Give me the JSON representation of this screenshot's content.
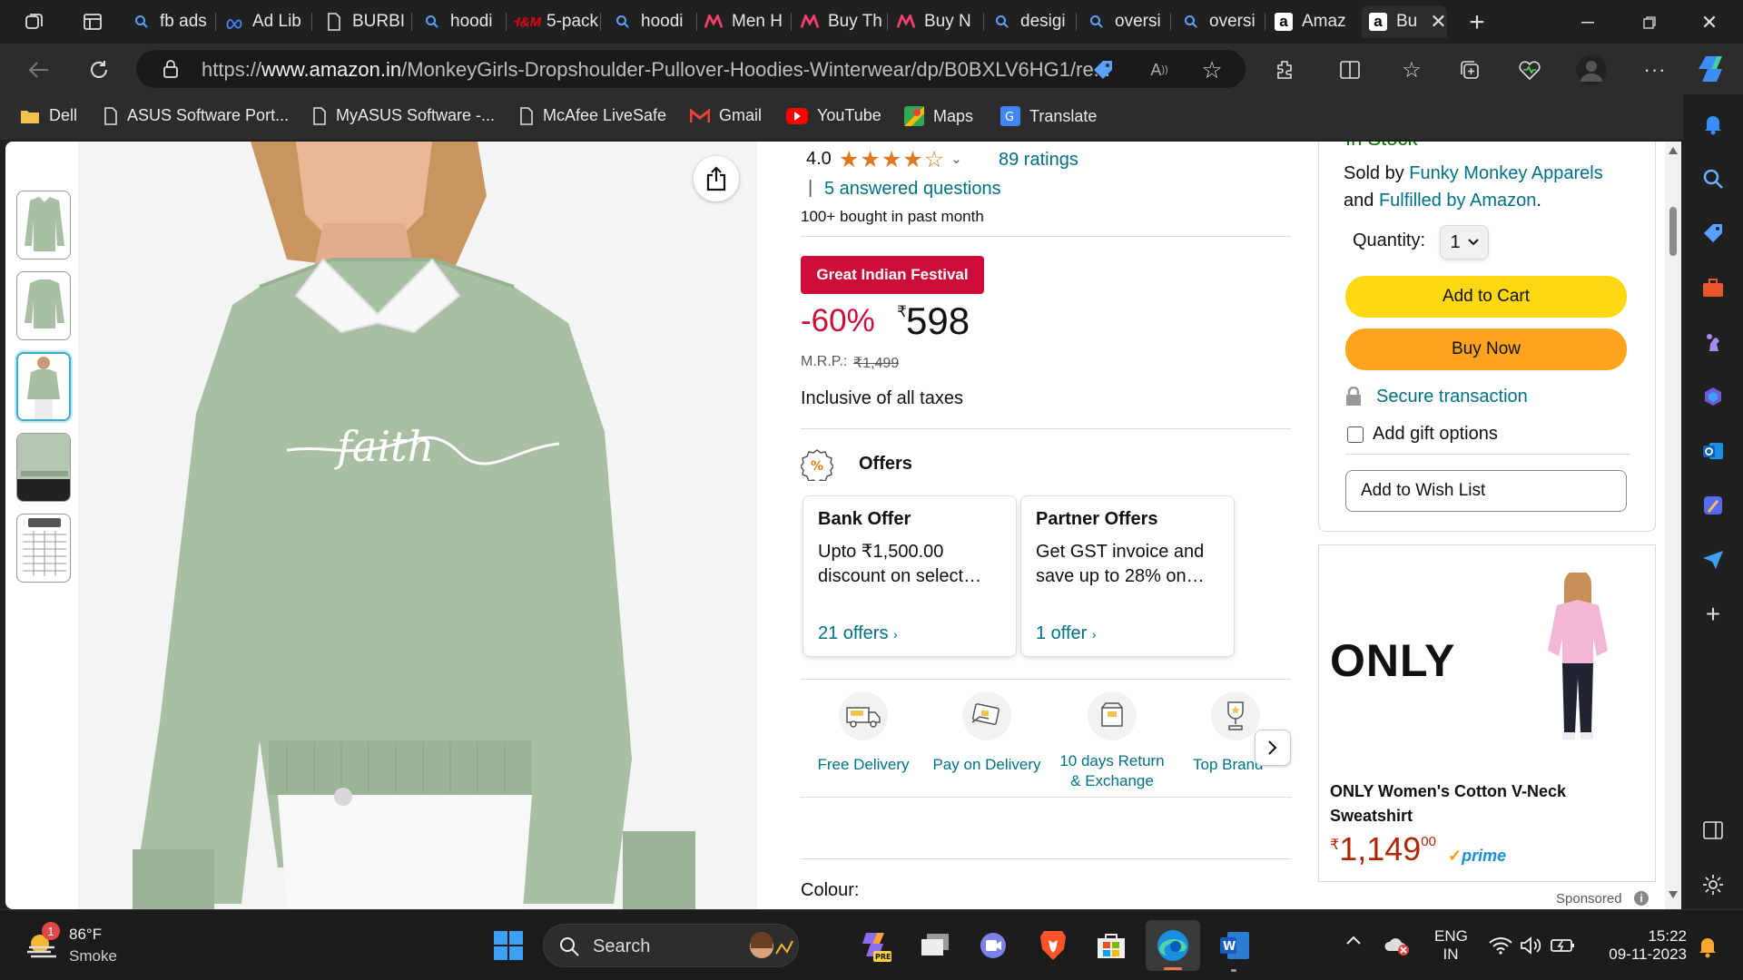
{
  "tabs": [
    {
      "label": "fb ads"
    },
    {
      "label": "Ad Lib"
    },
    {
      "label": "BURBI"
    },
    {
      "label": "hoodi"
    },
    {
      "label": "5-pack"
    },
    {
      "label": "hoodi"
    },
    {
      "label": "Men H"
    },
    {
      "label": "Buy Th"
    },
    {
      "label": "Buy N"
    },
    {
      "label": "desigi"
    },
    {
      "label": "oversi"
    },
    {
      "label": "oversi"
    },
    {
      "label": "Amaz"
    },
    {
      "label": "Bu"
    }
  ],
  "url": {
    "scheme": "https://",
    "domain": "www.amazon.in",
    "path": "/MonkeyGirls-Dropshoulder-Pullover-Hoodies-Winterwear/dp/B0BXLV6HG1/re..."
  },
  "bookmarks": [
    {
      "label": "Dell"
    },
    {
      "label": "ASUS Software Port..."
    },
    {
      "label": "MyASUS Software -..."
    },
    {
      "label": "McAfee LiveSafe"
    },
    {
      "label": "Gmail"
    },
    {
      "label": "YouTube"
    },
    {
      "label": "Maps"
    },
    {
      "label": "Translate"
    }
  ],
  "product": {
    "rating": "4.0",
    "ratings_count": "89 ratings",
    "answered": "5 answered questions",
    "bought": "100+ bought in past month",
    "deal_badge": "Great Indian Festival",
    "discount": "-60%",
    "currency": "₹",
    "price": "598",
    "mrp_label": "M.R.P.:",
    "mrp": "₹1,499",
    "taxes": "Inclusive of all taxes",
    "shirt_text": "faith",
    "colour_label": "Colour:"
  },
  "offers": {
    "title": "Offers",
    "cards": [
      {
        "title": "Bank Offer",
        "line1": "Upto ₹1,500.00",
        "line2": "discount on select…",
        "link": "21 offers"
      },
      {
        "title": "Partner Offers",
        "line1": "Get GST invoice and",
        "line2": "save up to 28% on…",
        "link": "1 offer"
      }
    ]
  },
  "services": [
    {
      "line1": "Free Delivery",
      "line2": ""
    },
    {
      "line1": "Pay on Delivery",
      "line2": ""
    },
    {
      "line1": "10 days Return",
      "line2": "& Exchange"
    },
    {
      "line1": "Top Brand",
      "line2": ""
    }
  ],
  "buybox": {
    "stock_partial": "In Stock",
    "sold_by": "Sold by",
    "seller": "Funky Monkey Apparels",
    "and": "and",
    "fulfilled": "Fulfilled by Amazon",
    "quantity_label": "Quantity:",
    "quantity_value": "1",
    "add_to_cart": "Add to Cart",
    "buy_now": "Buy Now",
    "secure": "Secure transaction",
    "gift": "Add gift options",
    "wishlist": "Add to Wish List"
  },
  "ad": {
    "brand": "ONLY",
    "title_line1": "ONLY Women's Cotton V-Neck",
    "title_line2": "Sweatshirt",
    "currency": "₹",
    "price": "1,149",
    "price_fraction": "00",
    "prime": "prime",
    "sponsored": "Sponsored"
  },
  "taskbar": {
    "temp": "86°F",
    "weather": "Smoke",
    "weather_badge": "1",
    "search": "Search",
    "lang1": "ENG",
    "lang2": "IN",
    "time": "15:22",
    "date": "09-11-2023"
  },
  "colors": {
    "amazon_link": "#007185",
    "deal_red": "#cc0c39",
    "cart_yellow": "#ffd814",
    "buy_orange": "#ffa41c",
    "star": "#ff9900"
  }
}
